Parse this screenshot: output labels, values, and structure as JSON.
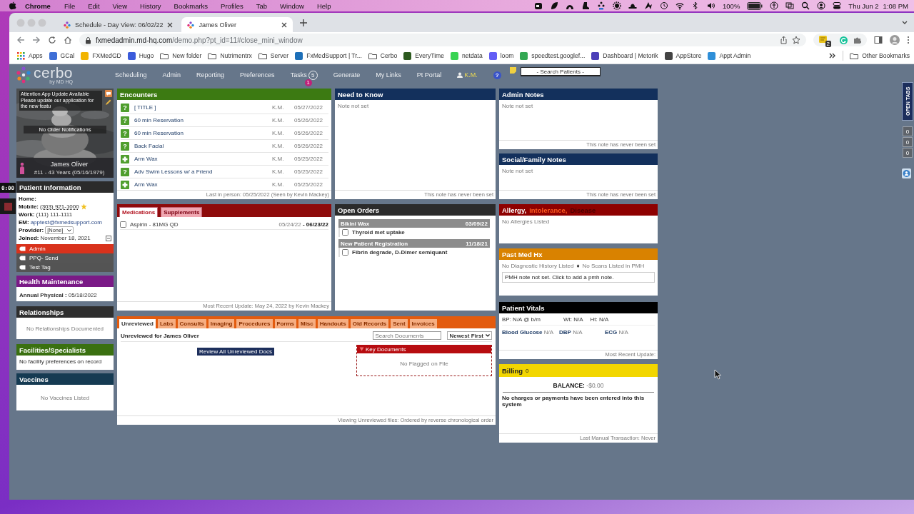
{
  "menubar": {
    "app": "Chrome",
    "menus": [
      "File",
      "Edit",
      "View",
      "History",
      "Bookmarks",
      "Profiles",
      "Tab",
      "Window",
      "Help"
    ],
    "battery": "100%",
    "date": "Thu Jun 2",
    "time": "1:08 PM"
  },
  "browser": {
    "tabs": [
      {
        "title": "Schedule - Day View: 06/02/22",
        "selected": false
      },
      {
        "title": "James Oliver",
        "selected": true
      }
    ],
    "address": {
      "host": "fxmedadmin.md-hq.com",
      "path": "/demo.php?pt_id=11#close_mini_window"
    },
    "extension_badge": "2",
    "bookmarks": [
      {
        "label": "Apps",
        "kind": "apps"
      },
      {
        "label": "GCal",
        "kind": "site",
        "color": "#3f6fd6"
      },
      {
        "label": "FXMedGD",
        "kind": "site",
        "color": "#f2b400"
      },
      {
        "label": "Hugo",
        "kind": "site",
        "color": "#3b5bdb"
      },
      {
        "label": "New folder",
        "kind": "folder"
      },
      {
        "label": "Nutrimentrx",
        "kind": "folder"
      },
      {
        "label": "Server",
        "kind": "folder"
      },
      {
        "label": "FxMedSupport | Tr...",
        "kind": "site",
        "color": "#1d6fb8"
      },
      {
        "label": "Cerbo",
        "kind": "folder"
      },
      {
        "label": "EveryTime",
        "kind": "site",
        "color": "#2d5a1f"
      },
      {
        "label": "netdata",
        "kind": "site",
        "color": "#39d353"
      },
      {
        "label": "loom",
        "kind": "site",
        "color": "#625df5"
      },
      {
        "label": "speedtest.googlef...",
        "kind": "site",
        "color": "#34a853"
      },
      {
        "label": "Dashboard | Metorik",
        "kind": "site",
        "color": "#4b3fb8"
      },
      {
        "label": "AppStore",
        "kind": "site",
        "color": "#444444"
      },
      {
        "label": "Appt Admin",
        "kind": "site",
        "color": "#2f8fd8"
      }
    ],
    "other_bookmarks": "Other Bookmarks"
  },
  "recorder": {
    "time": "0:00"
  },
  "app": {
    "logo": "cerbo",
    "logo_sub": "by MD HQ",
    "nav": [
      {
        "label": "Scheduling"
      },
      {
        "label": "Admin"
      },
      {
        "label": "Reporting"
      },
      {
        "label": "Preferences"
      },
      {
        "label": "Tasks",
        "count": "5",
        "alert": "1"
      },
      {
        "label": "Generate"
      },
      {
        "label": "My Links"
      },
      {
        "label": "Pt Portal"
      }
    ],
    "user": "K.M.",
    "help": "?",
    "search_placeholder": "- Search Patients -"
  },
  "open_tabs": {
    "label": "OPEN TABS",
    "counters": [
      "0",
      "0",
      "0"
    ]
  },
  "left_column": [
    {
      "kind": "patient_card",
      "notice_title": "Attention App Update Available",
      "notice_text": "Please update our application for the new featu",
      "notifications": "No Older Notifications",
      "name": "James Oliver",
      "details": "#11 - 43 Years (05/16/1979)"
    },
    {
      "kind": "patient_info",
      "title": "Patient Information",
      "color": "#2b2b2b",
      "fields": [
        {
          "kind": "text",
          "label": "Home:",
          "starred": false
        },
        {
          "kind": "phone",
          "label": "Mobile:",
          "value": "(303) 921-1000",
          "starred": true
        },
        {
          "kind": "text",
          "label": "Work:",
          "value": "(111) 111-1111",
          "starred": false
        },
        {
          "kind": "link",
          "label": "EM:",
          "value": "apptest@fxmedsupport.com",
          "starred": false
        },
        {
          "kind": "select",
          "label": "Provider:",
          "value": "[None]",
          "starred": false
        },
        {
          "kind": "expand",
          "label": "Joined:",
          "value": "November 18, 2021",
          "starred": false
        }
      ],
      "tags": [
        {
          "label": "Admin",
          "color": "#d9321c"
        },
        {
          "label": "PPQ- Send",
          "color": "#555555"
        },
        {
          "label": "Test Tag",
          "color": "#545454"
        }
      ]
    },
    {
      "kind": "key_value",
      "title": "Health Maintenance",
      "color": "#7a1a86",
      "items": [
        {
          "label": "Annual Physical :",
          "value": "05/18/2022"
        }
      ]
    },
    {
      "kind": "empty",
      "title": "Relationships",
      "color": "#2e2e2e",
      "text": "No Relationships Documented"
    },
    {
      "kind": "message",
      "title": "Facilities/Specialists",
      "color": "#3a7010",
      "text": "No facility preferences on record"
    },
    {
      "kind": "empty",
      "title": "Vaccines",
      "color": "#153a52",
      "text": "No Vaccines Listed"
    }
  ],
  "middle_column": [
    {
      "kind": "encounters",
      "title": "Encounters",
      "color": "#3c7a12",
      "rows": [
        {
          "kind": "question",
          "glyph": "?",
          "title": "[ TITLE ]",
          "provider": "K.M.",
          "date": "05/27/2022"
        },
        {
          "kind": "question",
          "glyph": "?",
          "title": "60 min Reservation",
          "provider": "K.M.",
          "date": "05/26/2022"
        },
        {
          "kind": "question",
          "glyph": "?",
          "title": "60 min Reservation",
          "provider": "K.M.",
          "date": "05/26/2022"
        },
        {
          "kind": "question",
          "glyph": "?",
          "title": "Back Facial",
          "provider": "K.M.",
          "date": "05/26/2022"
        },
        {
          "kind": "cross",
          "title": "Arm Wax",
          "provider": "K.M.",
          "date": "05/25/2022"
        },
        {
          "kind": "question",
          "glyph": "?",
          "title": "Adv Swim Lessons w/ a Friend",
          "provider": "K.M.",
          "date": "05/25/2022"
        },
        {
          "kind": "cross",
          "title": "Arm Wax",
          "provider": "K.M.",
          "date": "05/25/2022"
        }
      ],
      "footer": "Last in person: 05/25/2022 (Seen by Kevin Mackey)"
    },
    {
      "kind": "medications",
      "color": "#8e0b0b",
      "tabs": [
        {
          "label": "Medications",
          "selected": true
        },
        {
          "label": "Supplements",
          "selected": false
        }
      ],
      "rows": [
        {
          "name": "Aspirin - 81MG QD",
          "dates": "05/24/22 **- 06/23/22**",
          "checked": false
        }
      ],
      "footer": "Most Recent Update: May 24, 2022 by Kevin Mackey"
    }
  ],
  "notes_column": [
    {
      "kind": "note",
      "title": "Need to Know",
      "color": "#13305c",
      "text": "Note not set",
      "footer": "This note has never been set"
    },
    {
      "kind": "orders",
      "title": "Open Orders",
      "color": "#2b2b2b",
      "groups": [
        {
          "title": "Bikini Wax",
          "date": "03/09/22",
          "items": [
            {
              "label": "Thyroid met uptake",
              "checked": false
            }
          ]
        },
        {
          "title": "New Patient Registration",
          "date": "11/18/21",
          "items": [
            {
              "label": "Fibrin degrade, D-Dimer semiquant",
              "checked": false
            }
          ]
        }
      ]
    }
  ],
  "right_column": [
    {
      "kind": "note",
      "title": "Admin Notes",
      "color": "#13305c",
      "text": "Note not set",
      "footer": "This note has never been set"
    },
    {
      "kind": "note",
      "title": "Social/Family Notes",
      "color": "#13305c",
      "text": "Note not set",
      "footer": "This note has never been set"
    },
    {
      "kind": "allergy",
      "color": "#8e0000",
      "title_parts": [
        {
          "text": "Allergy,",
          "color": "#ffffff"
        },
        {
          "text": "Intolerance,",
          "color": "#ff5a1f"
        },
        {
          "text": "Disease",
          "color": "#4a0000"
        }
      ],
      "text": "No Allergies Listed"
    },
    {
      "kind": "past_med_hx",
      "title": "Past Med Hx",
      "color": "#d98200",
      "lines": [
        "No Diagnostic History Listed",
        "No Scans Listed in PMH"
      ],
      "separator": "♦",
      "note": "PMH note not set. Click to add a pmh note."
    },
    {
      "kind": "vitals",
      "title": "Patient Vitals",
      "color": "#000000",
      "readings": [
        {
          "label": "BP:",
          "value": "N/A @ b/m"
        },
        {
          "label": "Wt:",
          "value": "N/A"
        },
        {
          "label": "Ht:",
          "value": "N/A"
        }
      ],
      "measures": [
        {
          "label": "Blood Glucose",
          "value": "N/A"
        },
        {
          "label": "DBP",
          "value": "N/A"
        },
        {
          "label": "ECG",
          "value": "N/A"
        }
      ],
      "footer": "Most Recent Update:"
    },
    {
      "kind": "billing",
      "title": "Billing",
      "color": "#f2d600",
      "count": "0",
      "balance_label": "BALANCE:",
      "balance": "-$0.00",
      "text": "No charges or payments have been entered into this system",
      "footer": "Last Manual Transaction: Never"
    }
  ],
  "documents": {
    "kind": "documents",
    "color": "#e35b0e",
    "tabs": [
      {
        "label": "Unreviewed",
        "selected": true
      },
      {
        "label": "Labs",
        "selected": false
      },
      {
        "label": "Consults",
        "selected": false
      },
      {
        "label": "Imaging",
        "selected": false
      },
      {
        "label": "Procedures",
        "selected": false
      },
      {
        "label": "Forms",
        "selected": false
      },
      {
        "label": "Misc",
        "selected": false
      },
      {
        "label": "Handouts",
        "selected": false
      },
      {
        "label": "Old Records",
        "selected": false
      },
      {
        "label": "Sent",
        "selected": false
      },
      {
        "label": "Invoices",
        "selected": false
      }
    ],
    "heading": "Unreviewed for James Oliver",
    "search_placeholder": "Search Documents",
    "sort": "Newest First",
    "action": "Review All Unreviewed Docs",
    "key_documents": {
      "title": "Key Documents",
      "text": "No Flagged on File"
    },
    "footer": "Viewing Unreviewed files: Ordered by reverse chronological order"
  }
}
